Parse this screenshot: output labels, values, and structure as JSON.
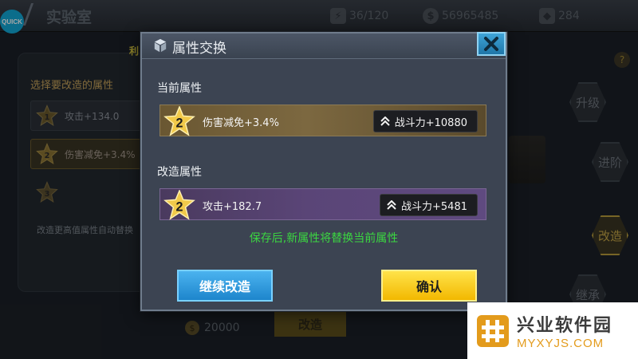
{
  "background": {
    "quick_label": "QUICK",
    "title": "实验室",
    "energy": "36/120",
    "gold": "56965485",
    "diamonds": "284",
    "left_panel_title": "选择要改造的属性",
    "rows": [
      {
        "level": "1",
        "text": "攻击+134.0"
      },
      {
        "level": "2",
        "text": "伤害减免+3.4%"
      },
      {
        "level": "3",
        "text": ""
      }
    ],
    "hint": "改造更高值属性自动替换",
    "side_buttons": [
      "升级",
      "进阶",
      "改造",
      "继承"
    ],
    "help": "?",
    "cost": "20000",
    "modify_button": "改造",
    "yellow_fragment": "利"
  },
  "dialog": {
    "title": "属性交换",
    "current_label": "当前属性",
    "current": {
      "level": "2",
      "attribute": "伤害减免+3.4%",
      "power": "战斗力+10880"
    },
    "modified_label": "改造属性",
    "modified": {
      "level": "2",
      "attribute": "攻击+182.7",
      "power": "战斗力+5481"
    },
    "notice": "保存后,新属性将替换当前属性",
    "continue_button": "继续改造",
    "confirm_button": "确认"
  },
  "watermark": {
    "cn": "兴业软件园",
    "en": "MYXYJS.COM"
  },
  "colors": {
    "notice_green": "#3bd641",
    "confirm_yellow": "#f7c912",
    "continue_blue": "#2d9ae0"
  }
}
